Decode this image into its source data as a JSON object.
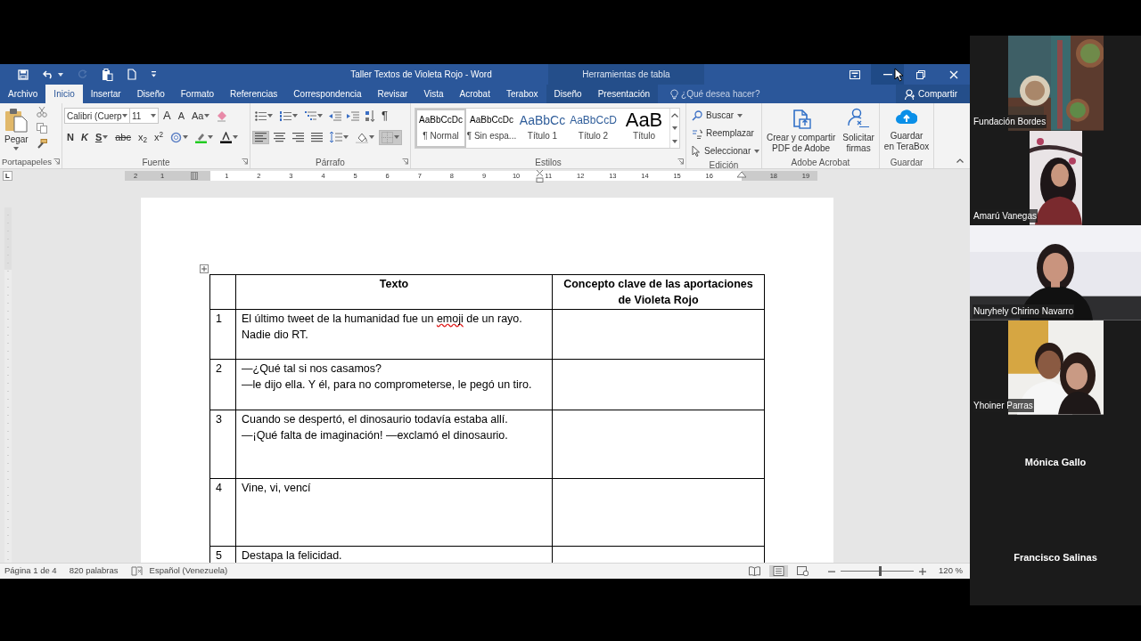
{
  "window": {
    "title": "Taller Textos de Violeta Rojo - Word",
    "contextual_group": "Herramientas de tabla"
  },
  "quick_access": [
    {
      "kind": "save",
      "disabled": false
    },
    {
      "kind": "undo",
      "disabled": false,
      "dropdown": true
    },
    {
      "kind": "redo",
      "disabled": true
    },
    {
      "kind": "touch",
      "disabled": false
    },
    {
      "kind": "newdoc",
      "disabled": false
    },
    {
      "kind": "customize",
      "disabled": false
    }
  ],
  "tabs": [
    {
      "label": "Archivo",
      "selected": false,
      "contextual": false
    },
    {
      "label": "Inicio",
      "selected": true,
      "contextual": false
    },
    {
      "label": "Insertar",
      "selected": false,
      "contextual": false
    },
    {
      "label": "Diseño",
      "selected": false,
      "contextual": false
    },
    {
      "label": "Formato",
      "selected": false,
      "contextual": false
    },
    {
      "label": "Referencias",
      "selected": false,
      "contextual": false
    },
    {
      "label": "Correspondencia",
      "selected": false,
      "contextual": false
    },
    {
      "label": "Revisar",
      "selected": false,
      "contextual": false
    },
    {
      "label": "Vista",
      "selected": false,
      "contextual": false
    },
    {
      "label": "Acrobat",
      "selected": false,
      "contextual": false
    },
    {
      "label": "Terabox",
      "selected": false,
      "contextual": false
    },
    {
      "label": "Diseño",
      "selected": false,
      "contextual": true
    },
    {
      "label": "Presentación",
      "selected": false,
      "contextual": true
    }
  ],
  "search": {
    "placeholder": "¿Qué desea hacer?"
  },
  "share": {
    "label": "Compartir"
  },
  "ribbon": [
    {
      "kind": "clipboard",
      "label": "Portapapeles",
      "launcher": true,
      "paste_label": "Pegar"
    },
    {
      "kind": "font",
      "label": "Fuente",
      "launcher": true,
      "font": "Calibri (Cuerp",
      "size": "11",
      "row1": [
        {
          "kind": "grow",
          "label": "A"
        },
        {
          "kind": "shrink",
          "label": "A"
        },
        {
          "kind": "case",
          "label": "Aa",
          "dropdown": true
        },
        {
          "kind": "clear"
        }
      ],
      "row2": [
        {
          "kind": "bold",
          "label": "N"
        },
        {
          "kind": "italic",
          "label": "K"
        },
        {
          "kind": "underline",
          "label": "S",
          "dropdown": true
        },
        {
          "kind": "strike",
          "label": "abc"
        },
        {
          "kind": "sub",
          "label": "x$_{2}$"
        },
        {
          "kind": "sup",
          "label": "x$^{2}$"
        },
        {
          "kind": "effects",
          "dropdown": true
        },
        {
          "kind": "highlight",
          "dropdown": true
        },
        {
          "kind": "fontcolor",
          "dropdown": true
        }
      ]
    },
    {
      "kind": "paragraph",
      "label": "Párrafo",
      "launcher": true,
      "row1": [
        {
          "kind": "bullets",
          "dropdown": true
        },
        {
          "kind": "numbering",
          "dropdown": true
        },
        {
          "kind": "multilevel",
          "dropdown": true
        },
        {
          "kind": "outdent"
        },
        {
          "kind": "indent"
        },
        {
          "kind": "sort"
        },
        {
          "kind": "marks",
          "label": "¶"
        }
      ],
      "row2": [
        {
          "kind": "align-left",
          "selected": true
        },
        {
          "kind": "align-center",
          "selected": false
        },
        {
          "kind": "align-right",
          "selected": false
        },
        {
          "kind": "justify",
          "selected": false
        },
        {
          "kind": "spacing",
          "dropdown": true
        },
        {
          "kind": "shading",
          "dropdown": true
        },
        {
          "kind": "borders",
          "dropdown": true,
          "selected": true
        }
      ]
    },
    {
      "kind": "styles",
      "label": "Estilos",
      "launcher": true,
      "items": [
        {
          "kind": "normal",
          "preview": "AaBbCcDc",
          "label": "¶ Normal",
          "selected": true
        },
        {
          "kind": "normal",
          "preview": "AaBbCcDc",
          "label": "¶ Sin espa...",
          "selected": false
        },
        {
          "kind": "heading1",
          "preview": "AaBbCc",
          "label": "Título 1",
          "selected": false
        },
        {
          "kind": "heading2",
          "preview": "AaBbCcD",
          "label": "Título 2",
          "selected": false
        },
        {
          "kind": "title",
          "preview": "AaB",
          "label": "Título",
          "selected": false
        }
      ]
    },
    {
      "kind": "editing",
      "label": "Edición",
      "items": [
        {
          "kind": "find",
          "label": "Buscar",
          "dropdown": true
        },
        {
          "kind": "replace",
          "label": "Reemplazar"
        },
        {
          "kind": "select",
          "label": "Seleccionar",
          "dropdown": true
        }
      ]
    },
    {
      "kind": "big",
      "label": "Adobe Acrobat",
      "buttons": [
        {
          "kind": "pdf",
          "lines": [
            "Crear y compartir",
            "PDF de Adobe"
          ]
        },
        {
          "kind": "sign",
          "lines": [
            "Solicitar",
            "firmas"
          ]
        }
      ]
    },
    {
      "kind": "big",
      "label": "Guardar",
      "buttons": [
        {
          "kind": "cloud",
          "lines": [
            "Guardar",
            "en TeraBox"
          ]
        }
      ]
    }
  ],
  "ruler": [
    {
      "label": "2"
    },
    {
      "label": "1"
    },
    {
      "kind": "margin"
    },
    {
      "label": "1"
    },
    {
      "label": "2"
    },
    {
      "label": "3"
    },
    {
      "label": "4"
    },
    {
      "label": "5"
    },
    {
      "label": "6"
    },
    {
      "label": "7"
    },
    {
      "label": "8"
    },
    {
      "label": "9"
    },
    {
      "label": "10"
    },
    {
      "label": "11"
    },
    {
      "label": "12"
    },
    {
      "label": "13"
    },
    {
      "label": "14"
    },
    {
      "label": "15"
    },
    {
      "label": "16"
    },
    {
      "kind": "indent"
    },
    {
      "label": "18"
    },
    {
      "label": "19"
    }
  ],
  "table": {
    "columns": [
      "",
      "Texto",
      "Concepto clave de las aportaciones de Violeta Rojo"
    ],
    "rows": [
      {
        "number": "1",
        "lines": [
          {
            "segments": [
              {
                "text": "El último tweet de la humanidad fue un ",
                "misspelled": false
              },
              {
                "text": "emoji",
                "misspelled": true
              },
              {
                "text": " de un rayo.",
                "misspelled": false
              }
            ]
          },
          {
            "text": "Nadie dio RT."
          }
        ]
      },
      {
        "number": "2",
        "lines": [
          {
            "text": "—¿Qué tal si nos casamos?"
          },
          {
            "text": "—le dijo ella. Y él, para no comprometerse, le pegó un tiro."
          }
        ]
      },
      {
        "number": "3",
        "lines": [
          {
            "text": "Cuando se despertó, el dinosaurio todavía estaba allí."
          },
          {
            "text": "—¡Qué falta de imaginación! —exclamó el dinosaurio."
          }
        ]
      },
      {
        "number": "4",
        "lines": [
          {
            "text": "Vine, vi, vencí"
          }
        ]
      },
      {
        "number": "5",
        "lines": [
          {
            "text": "Destapa la felicidad."
          }
        ]
      }
    ]
  },
  "status_bar": {
    "page": "Página 1 de 4",
    "words": "820 palabras",
    "language": "Español (Venezuela)",
    "views": [
      {
        "kind": "read",
        "selected": false
      },
      {
        "kind": "print",
        "selected": true
      },
      {
        "kind": "web",
        "selected": false
      }
    ],
    "zoom": {
      "level": 0.53,
      "label": "120 %"
    }
  },
  "participants": [
    {
      "kind": "video",
      "name": "Fundación Bordes"
    },
    {
      "kind": "video",
      "name": "Amarú Vanegas"
    },
    {
      "kind": "video",
      "name": "Nuryhely Chirino Navarro"
    },
    {
      "kind": "video",
      "name": "Yhoiner Parras"
    },
    {
      "kind": "name",
      "name": "Mónica Gallo"
    },
    {
      "kind": "name",
      "name": "Francisco Salinas"
    }
  ]
}
